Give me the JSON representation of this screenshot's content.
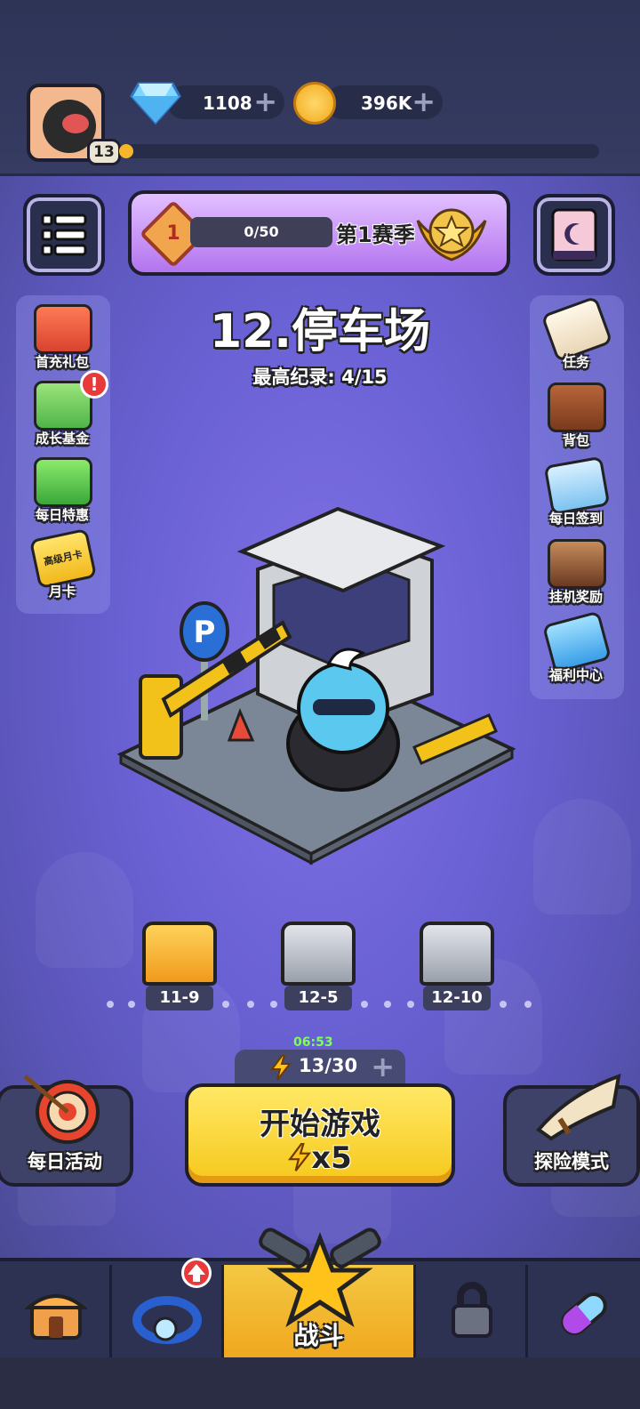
{
  "player": {
    "level": "13",
    "xp_fraction": 0.03
  },
  "currencies": {
    "gems": {
      "value": "1108",
      "plus": "+"
    },
    "gold": {
      "value": "396K",
      "plus": "+"
    }
  },
  "season": {
    "rank": "1",
    "progress": "0/50",
    "title": "第1赛季"
  },
  "stage": {
    "title": "12.停车场",
    "record": "最高纪录: 4/15"
  },
  "left_menu": [
    {
      "label": "首充礼包",
      "icon": "gift-icon"
    },
    {
      "label": "成长基金",
      "icon": "growth-fund-icon",
      "badge": "!"
    },
    {
      "label": "每日特惠",
      "icon": "shopping-basket-icon"
    },
    {
      "label": "月卡",
      "icon": "monthly-card-icon",
      "card_text": "高级月卡"
    }
  ],
  "right_menu": [
    {
      "label": "任务",
      "icon": "scroll-icon"
    },
    {
      "label": "背包",
      "icon": "backpack-icon"
    },
    {
      "label": "每日签到",
      "icon": "clipboard-icon"
    },
    {
      "label": "挂机奖励",
      "icon": "hourglass-icon"
    },
    {
      "label": "福利中心",
      "icon": "megaphone-icon"
    }
  ],
  "chests": [
    {
      "label": "11-9",
      "type": "gold"
    },
    {
      "label": "12-5",
      "type": "silver"
    },
    {
      "label": "12-10",
      "type": "silver"
    }
  ],
  "energy": {
    "timer": "06:53",
    "value": "13/30",
    "plus": "+"
  },
  "start_button": {
    "label": "开始游戏",
    "cost": "x5"
  },
  "side_modes": {
    "daily": "每日活动",
    "adventure": "探险模式"
  },
  "nav": [
    {
      "id": "shop",
      "label": "",
      "icon": "shop-icon"
    },
    {
      "id": "equipment",
      "label": "",
      "icon": "ring-icon",
      "badge": "up-arrow"
    },
    {
      "id": "battle",
      "label": "战斗",
      "icon": "star-cannon-icon"
    },
    {
      "id": "locked",
      "label": "",
      "icon": "lock-icon"
    },
    {
      "id": "capsule",
      "label": "",
      "icon": "capsule-icon"
    }
  ],
  "colors": {
    "accent_yellow": "#f6c81b",
    "stage_purple": "#6b62d6",
    "energy_green": "#7dff5a"
  }
}
